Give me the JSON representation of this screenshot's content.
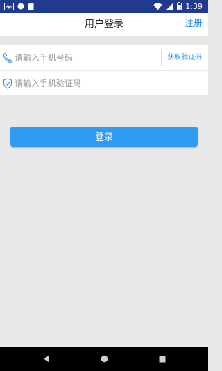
{
  "status_bar": {
    "time": "1:39",
    "icons": [
      "activity-icon",
      "circle-icon",
      "sd-card-icon",
      "wifi-icon",
      "signal-icon",
      "battery-icon"
    ]
  },
  "header": {
    "title": "用户登录",
    "register_label": "注册"
  },
  "form": {
    "phone": {
      "placeholder": "请输入手机号码",
      "value": "",
      "icon": "phone-icon"
    },
    "get_code_label": "获取验证码",
    "code": {
      "placeholder": "请输入手机验证码",
      "value": "",
      "icon": "shield-check-icon"
    }
  },
  "login_button_label": "登录",
  "colors": {
    "status_bar": "#1f3a8f",
    "accent": "#2a8cf0",
    "button": "#2f9bf2",
    "background": "#e8e8e8"
  },
  "system_nav": {
    "icons": [
      "back-icon",
      "home-icon",
      "recents-icon"
    ]
  }
}
